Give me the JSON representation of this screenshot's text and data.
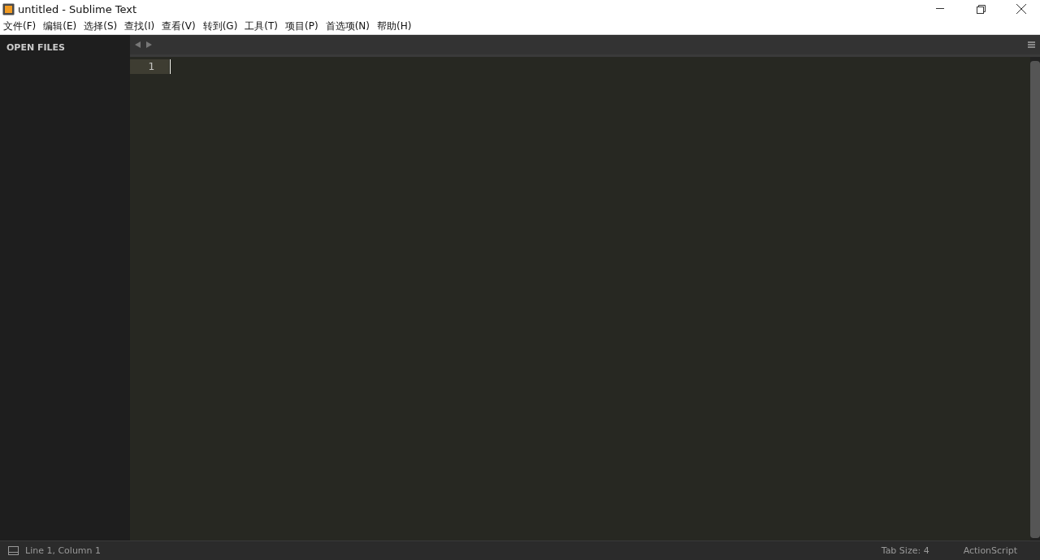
{
  "window": {
    "title": "untitled - Sublime Text"
  },
  "menu": [
    "文件(F)",
    "编辑(E)",
    "选择(S)",
    "查找(I)",
    "查看(V)",
    "转到(G)",
    "工具(T)",
    "项目(P)",
    "首选项(N)",
    "帮助(H)"
  ],
  "sidebar": {
    "title": "OPEN FILES"
  },
  "editor": {
    "lines": [
      {
        "number": "1",
        "selected": true
      }
    ]
  },
  "status_bar": {
    "position": "Line 1, Column 1",
    "tab_size": "Tab Size: 4",
    "syntax": "ActionScript"
  }
}
